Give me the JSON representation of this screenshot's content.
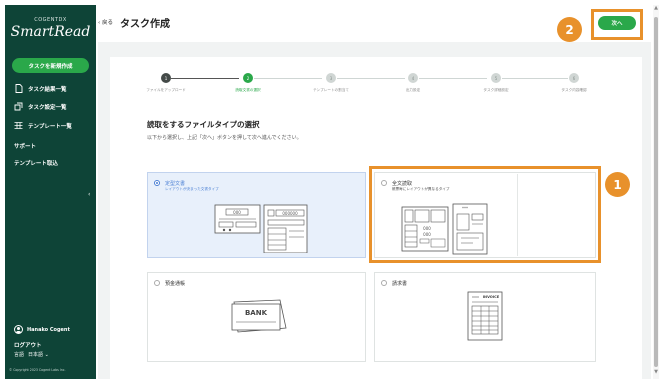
{
  "sidebar": {
    "company": "COGENTDX",
    "product": "SmartRead",
    "new_task_label": "タスクを新規作成",
    "nav": [
      {
        "label": "タスク結果一覧",
        "icon": "document-icon"
      },
      {
        "label": "タスク設定一覧",
        "icon": "settings-icon"
      },
      {
        "label": "テンプレート一覧",
        "icon": "template-icon"
      }
    ],
    "support_label": "サポート",
    "template_import_label": "テンプレート取込",
    "collapse_glyph": "‹",
    "user_name": "Hanako Cogent",
    "logout_label": "ログアウト",
    "lang_label": "言語",
    "lang_value": "日本語 ⌄",
    "copyright": "© Copyright 2023 Cogent Labs Inc."
  },
  "header": {
    "back_label": "‹ 戻る",
    "title": "タスク作成",
    "next_label": "次へ",
    "badge_2": "2"
  },
  "steps": [
    {
      "number": "1",
      "label": "ファイルをアップロード"
    },
    {
      "number": "2",
      "label": "読取文書の選択"
    },
    {
      "number": "3",
      "label": "テンプレートの割当て"
    },
    {
      "number": "4",
      "label": "出力設定"
    },
    {
      "number": "5",
      "label": "タスク詳細設定"
    },
    {
      "number": "6",
      "label": "タスク内容確認"
    }
  ],
  "section": {
    "title": "読取をするファイルタイプの選択",
    "description": "以下から選択し、上記「次へ」ボタンを押して次へ進んでください。"
  },
  "cards": {
    "fixed": {
      "title": "定型文書",
      "subtitle": "レイアウトが決まった文書タイプ",
      "illus_code": "000000"
    },
    "full_text": {
      "title": "全文読取",
      "subtitle": "帳票毎にレイアウトが異なるタイプ"
    },
    "bank": {
      "title": "預金通帳",
      "illus_text": "BANK"
    },
    "invoice": {
      "title": "請求書",
      "illus_text": "INVOICE"
    }
  },
  "annotations": {
    "badge_1": "1"
  },
  "colors": {
    "sidebar_bg": "#0e4437",
    "accent_green": "#2aa84a",
    "highlight_orange": "#e8912b",
    "selected_blue": "#4a7fd4"
  }
}
